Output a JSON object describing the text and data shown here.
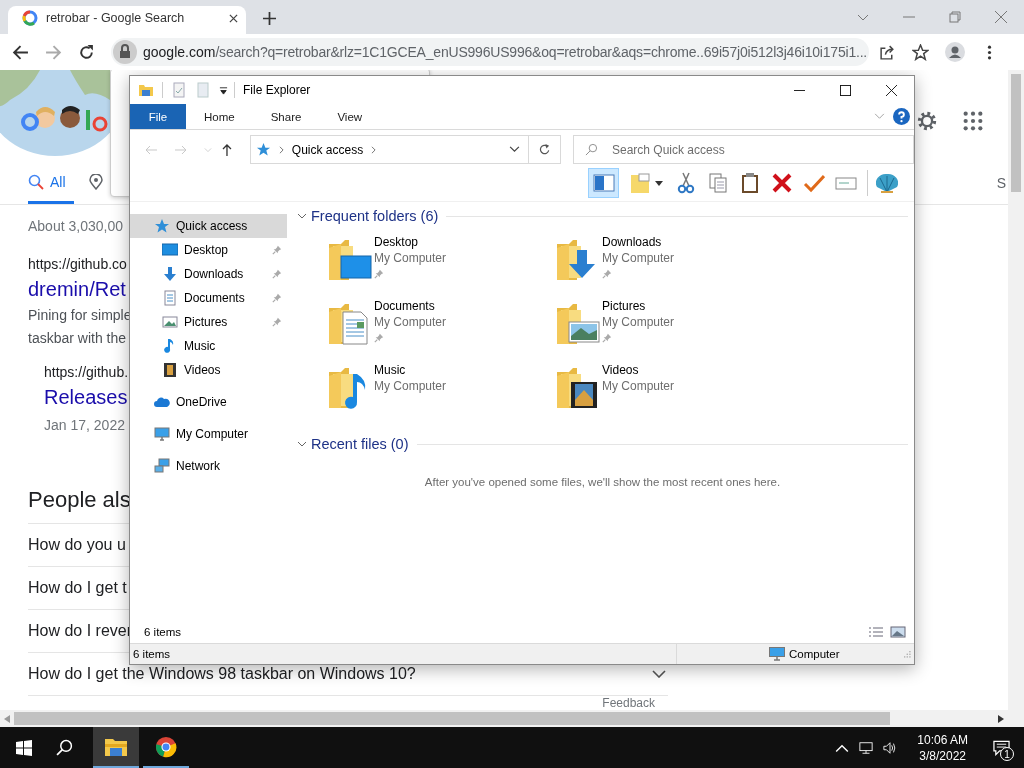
{
  "browser": {
    "tab_title": "retrobar - Google Search",
    "url_host": "google.com",
    "url_rest": "/search?q=retrobar&rlz=1C1GCEA_enUS996US996&oq=retrobar&aqs=chrome..69i57j0i512l3j46i10i175i1..."
  },
  "google": {
    "tabs": [
      {
        "label": "All",
        "selected": true,
        "kind": "search"
      },
      {
        "selected": false,
        "kind": "maps"
      }
    ],
    "tab_cut": "S",
    "results_count": "About 3,030,00",
    "result": {
      "url": "https://github.co",
      "title": "dremin/Ret",
      "snippet": [
        "Pining for simple",
        "taskbar with the"
      ],
      "sub_url": "https://github.",
      "sub_title": "Releases",
      "sub_date": "Jan 17, 2022"
    },
    "people_heading": "People als",
    "questions": [
      "How do you u",
      "How do I get t",
      "How do I rever",
      "How do I get the Windows 98 taskbar on Windows 10?"
    ],
    "feedback": "Feedback"
  },
  "explorer": {
    "title": "File Explorer",
    "ribbon_tabs": [
      {
        "label": "File",
        "selected": true
      },
      {
        "label": "Home",
        "selected": false
      },
      {
        "label": "Share",
        "selected": false
      },
      {
        "label": "View",
        "selected": false
      }
    ],
    "address": "Quick access",
    "search_placeholder": "Search Quick access",
    "nav": [
      {
        "label": "Quick access",
        "kind": "star",
        "selected": true,
        "children": [
          {
            "label": "Desktop",
            "kind": "desktop",
            "pinned": true,
            "selected": false
          },
          {
            "label": "Downloads",
            "kind": "downloads",
            "pinned": true,
            "selected": false
          },
          {
            "label": "Documents",
            "kind": "documents",
            "pinned": true,
            "selected": false
          },
          {
            "label": "Pictures",
            "kind": "pictures",
            "pinned": true,
            "selected": false
          },
          {
            "label": "Music",
            "kind": "music",
            "pinned": false,
            "selected": false
          },
          {
            "label": "Videos",
            "kind": "videos",
            "pinned": false,
            "selected": false
          }
        ]
      },
      {
        "label": "OneDrive",
        "kind": "cloud",
        "selected": false
      },
      {
        "label": "My Computer",
        "kind": "computer",
        "selected": false
      },
      {
        "label": "Network",
        "kind": "network",
        "selected": false
      }
    ],
    "frequent": {
      "heading": "Frequent folders (6)",
      "expanded": true,
      "folders": [
        {
          "name": "Desktop",
          "location": "My Computer",
          "kind": "desktop",
          "pinned": true
        },
        {
          "name": "Downloads",
          "location": "My Computer",
          "kind": "downloads",
          "pinned": true
        },
        {
          "name": "Documents",
          "location": "My Computer",
          "kind": "documents",
          "pinned": true
        },
        {
          "name": "Pictures",
          "location": "My Computer",
          "kind": "pictures",
          "pinned": true
        },
        {
          "name": "Music",
          "location": "My Computer",
          "kind": "music",
          "pinned": false
        },
        {
          "name": "Videos",
          "location": "My Computer",
          "kind": "videos",
          "pinned": false
        }
      ]
    },
    "recent": {
      "heading": "Recent files (0)",
      "expanded": true,
      "empty_message": "After you've opened some files, we'll show the most recent ones here."
    },
    "item_count": "6 items",
    "status_items": "6 items",
    "status_location": "Computer"
  },
  "taskbar": {
    "apps": [
      {
        "kind": "explorer",
        "selected": true
      },
      {
        "kind": "chrome",
        "selected": false
      }
    ],
    "time": "10:06 AM",
    "date": "3/8/2022",
    "notifications": "1"
  }
}
